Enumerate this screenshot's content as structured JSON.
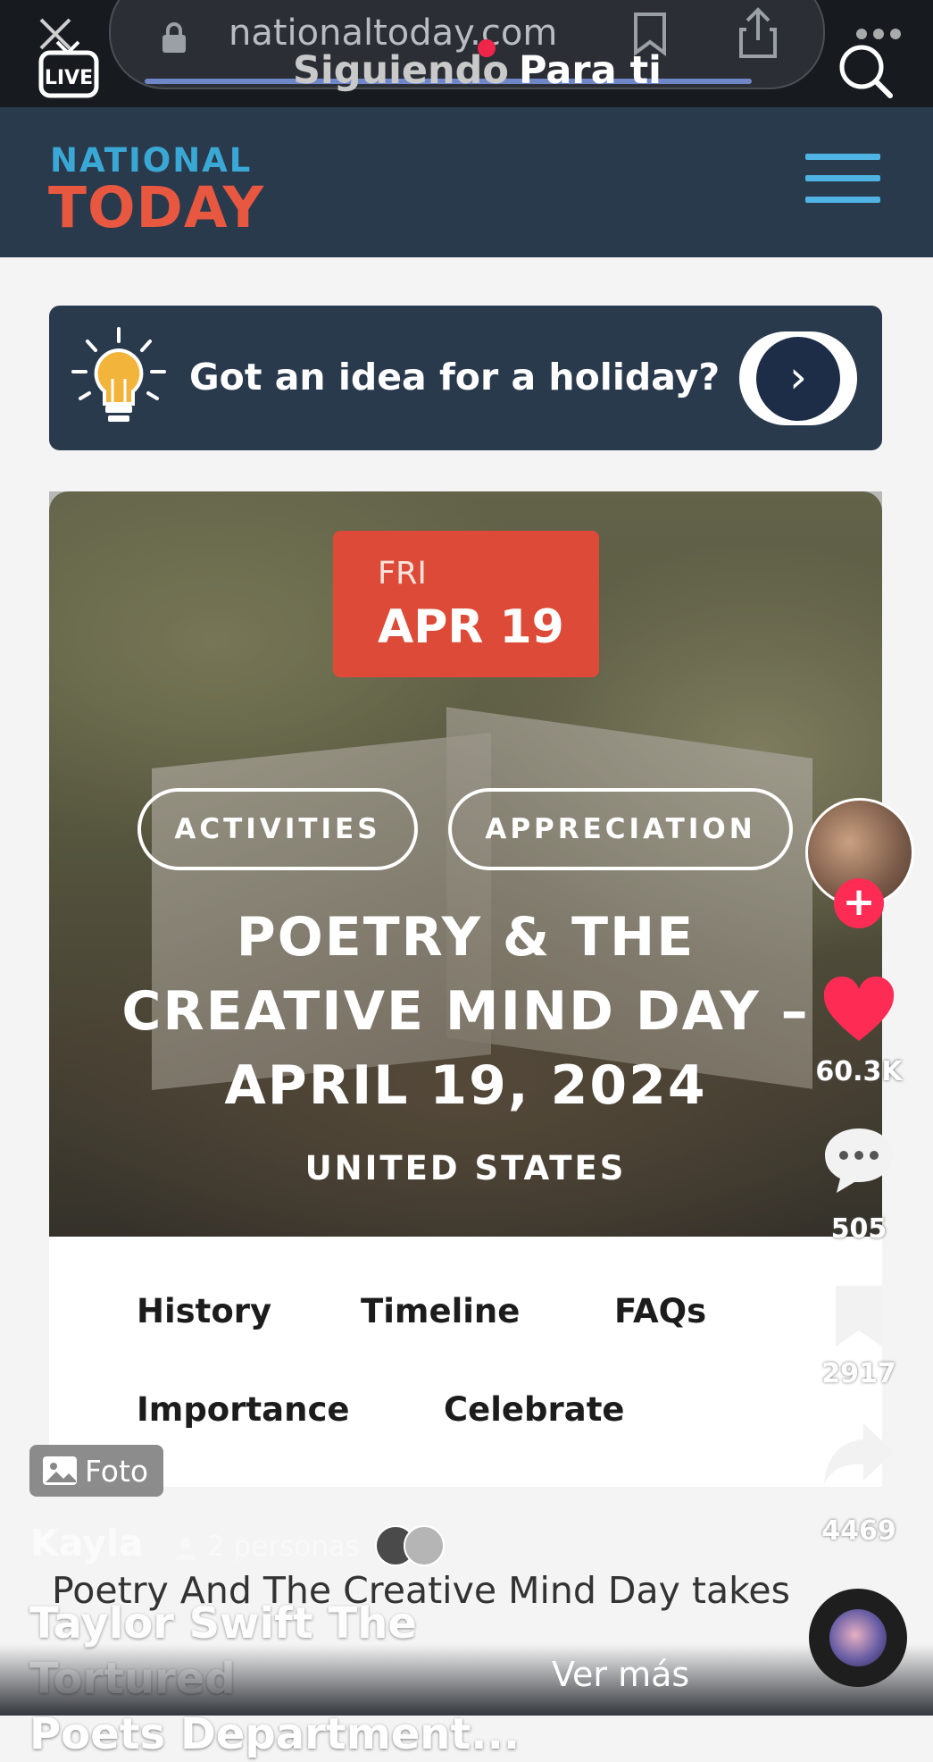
{
  "browser": {
    "url": "nationaltoday.com"
  },
  "tiktok_tabs": {
    "following": "Siguiendo",
    "for_you": "Para ti"
  },
  "site": {
    "logo_line1": "NATIONAL",
    "logo_line2": "TODAY",
    "banner_text": "Got an idea for a holiday?",
    "banner_arrow": "›"
  },
  "hero": {
    "day_of_week": "FRI",
    "date": "APR 19",
    "tags": [
      "ACTIVITIES",
      "APPRECIATION"
    ],
    "title_lines": [
      "POETRY & THE",
      "CREATIVE MIND DAY –",
      "APRIL 19, 2024"
    ],
    "country": "UNITED STATES"
  },
  "page_nav": {
    "row1": [
      "History",
      "Timeline",
      "FAQs"
    ],
    "row2": [
      "Importance",
      "Celebrate"
    ]
  },
  "rail": {
    "likes": "60.3K",
    "comments": "505",
    "saves": "2917",
    "shares": "4469",
    "follow_symbol": "+"
  },
  "post": {
    "type_badge": "Foto",
    "author": "Kayla",
    "people": "2 personas",
    "caption": "Poetry And The Creative Mind Day takes",
    "music_line1": "Taylor Swift The Tortured",
    "music_line2": "Poets Department...",
    "see_more": "Ver más"
  },
  "colors": {
    "header_navy": "#2a3a4d",
    "logo_blue": "#3aa8d5",
    "logo_orange": "#e8573f",
    "date_red": "#dd4b38",
    "tiktok_red": "#fe2c55"
  }
}
